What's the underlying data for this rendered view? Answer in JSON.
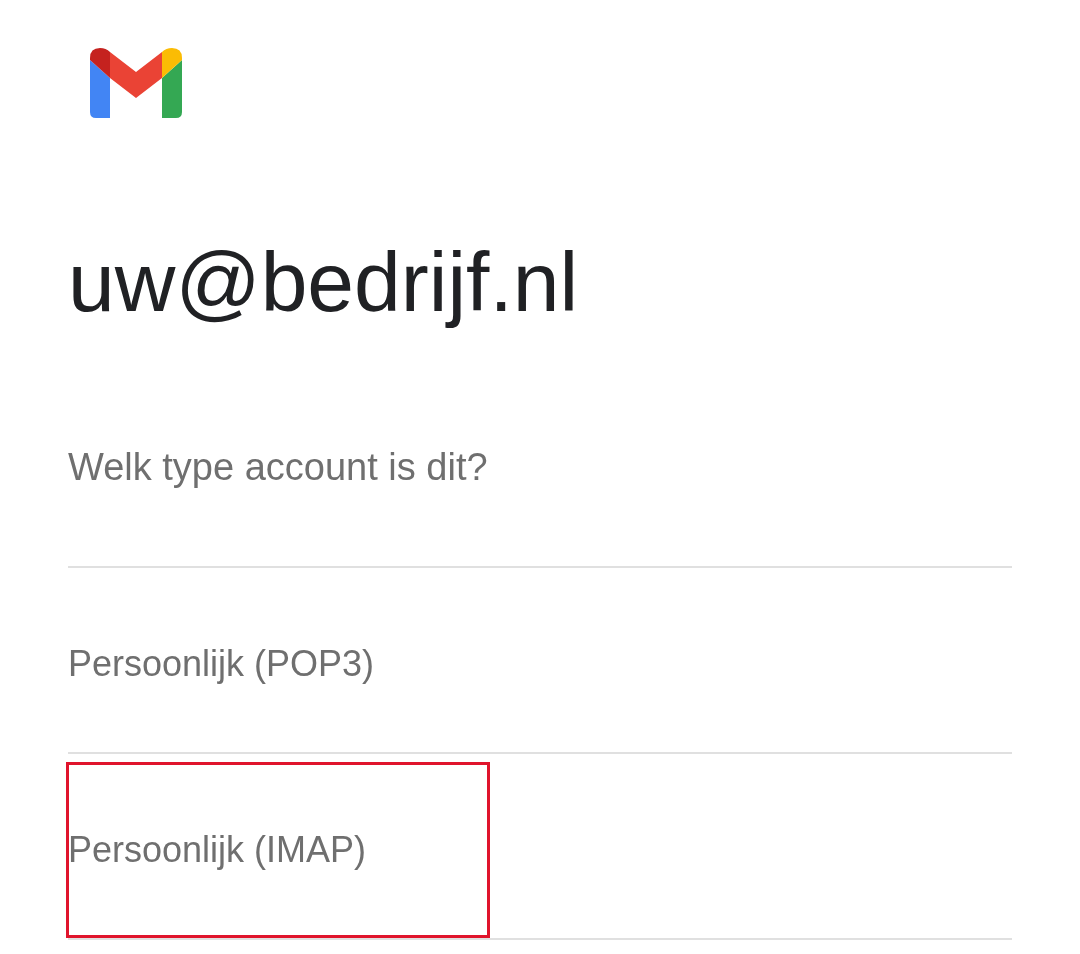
{
  "account_email": "uw@bedrijf.nl",
  "prompt": "Welk type account is dit?",
  "options": [
    {
      "label": "Persoonlijk (POP3)",
      "highlighted": false
    },
    {
      "label": "Persoonlijk (IMAP)",
      "highlighted": true
    }
  ]
}
